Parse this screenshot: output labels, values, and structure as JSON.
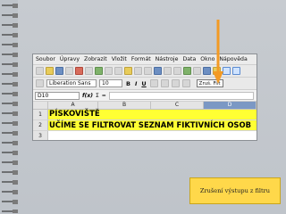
{
  "menu": [
    "Soubor",
    "Úpravy",
    "Zobrazit",
    "Vložit",
    "Formát",
    "Nástroje",
    "Data",
    "Okno",
    "Nápověda"
  ],
  "toolbar": {
    "font_name": "Liberation Sans",
    "font_size": "10",
    "tooltip": "Zruš. Filt"
  },
  "formula_bar": {
    "name_box": "D10",
    "sum_symbol": "Σ",
    "equals_symbol": "="
  },
  "grid": {
    "columns": [
      "A",
      "B",
      "C",
      "D"
    ],
    "rows": [
      {
        "num": "1",
        "text": "PÍSKOVIŠTĚ"
      },
      {
        "num": "2",
        "text": "UČÍME SE FILTROVAT SEZNAM FIKTIVNÍCH OSOB"
      },
      {
        "num": "3",
        "text": ""
      }
    ]
  },
  "caption": "Zrušení výstupu z filtru",
  "colors": {
    "highlight": "#ffff33",
    "arrow": "#f39a24",
    "caption_bg": "#ffd84a",
    "selected_col": "#7b98c4"
  }
}
